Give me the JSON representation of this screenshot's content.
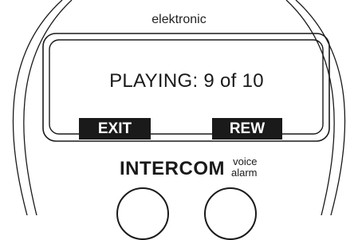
{
  "panel": {
    "brand_top": "elektronic",
    "display": {
      "status_text": "PLAYING: 9 of 10"
    },
    "softkeys": {
      "left_label": "EXIT",
      "right_label": "REW"
    },
    "brand_bottom": {
      "main": "INTERCOM",
      "sub_line1": "voice",
      "sub_line2": "alarm"
    }
  },
  "colors": {
    "ink": "#1a1a1a",
    "background": "#ffffff",
    "softkey_text": "#ffffff"
  }
}
